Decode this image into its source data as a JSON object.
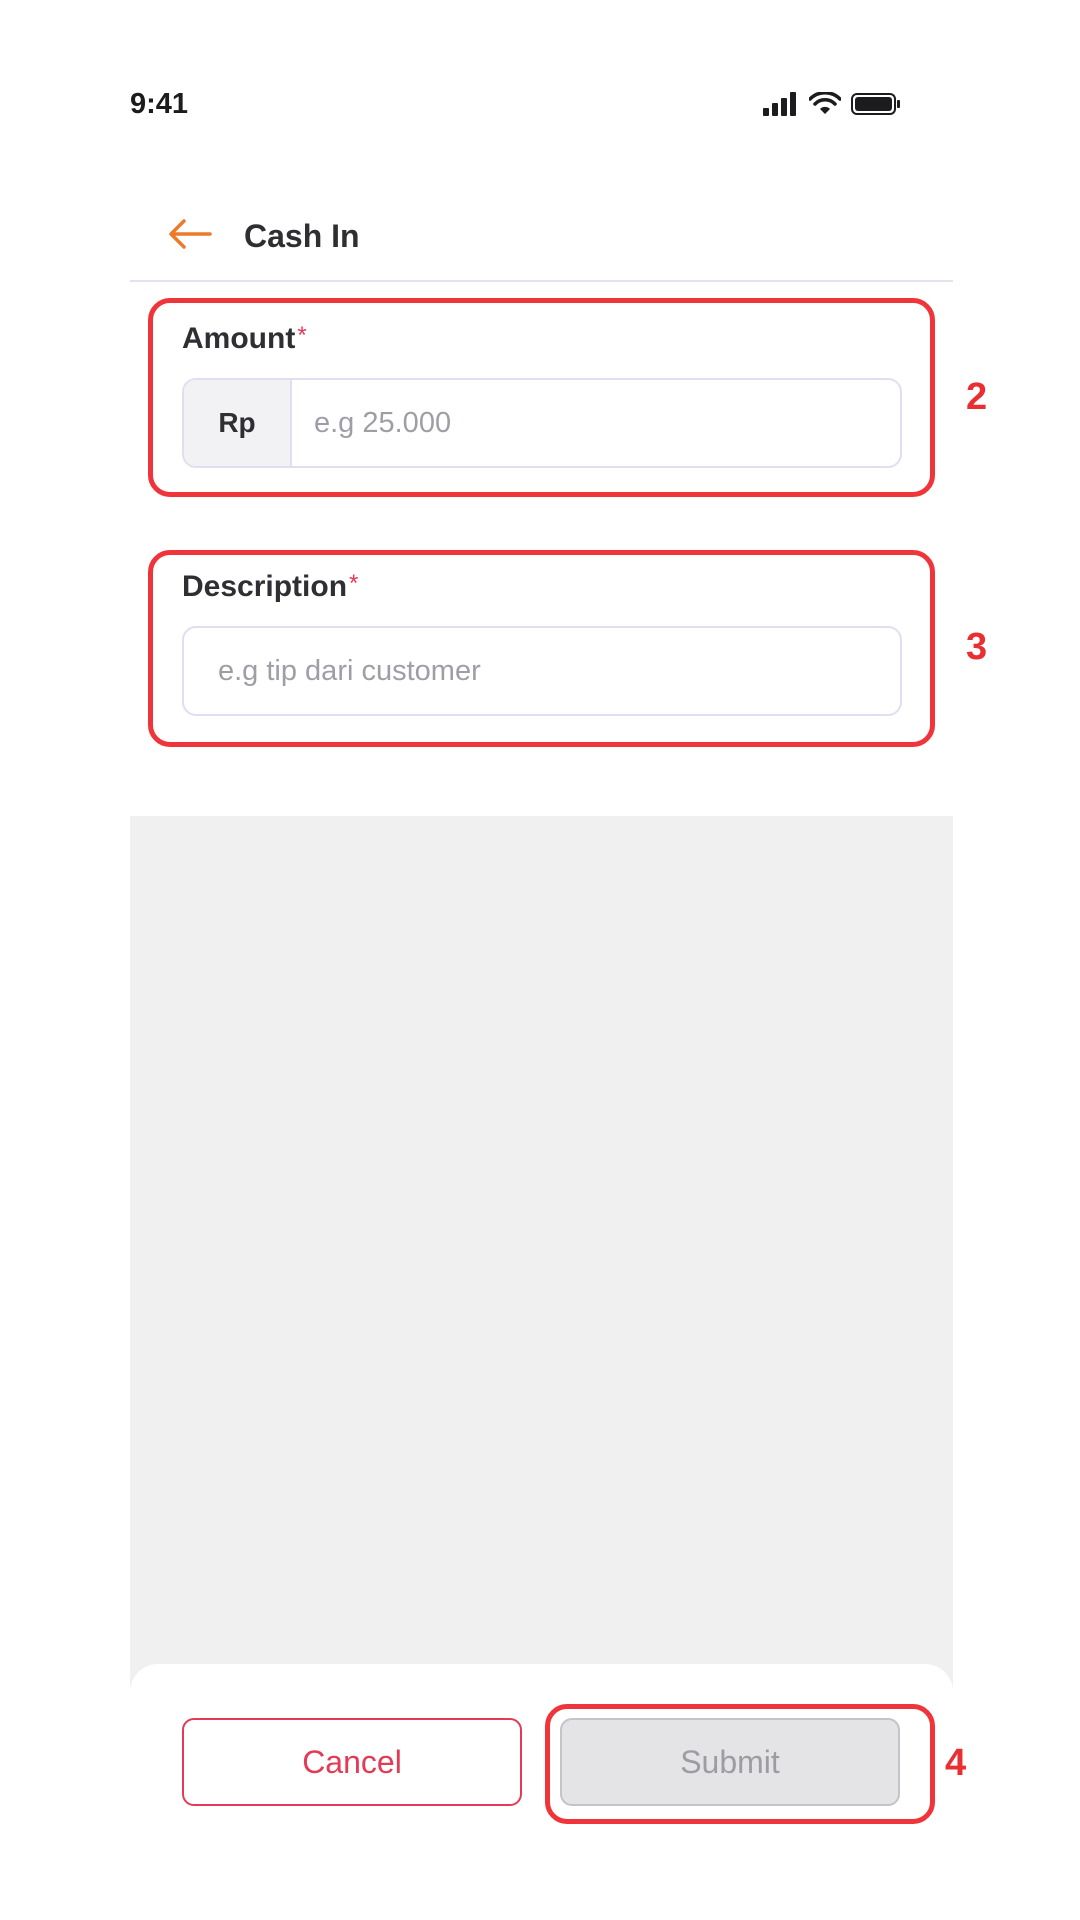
{
  "status_bar": {
    "time": "9:41",
    "signal_icon": "signal-bars-icon",
    "wifi_icon": "wifi-icon",
    "battery_icon": "battery-icon"
  },
  "header": {
    "back_icon": "arrow-left-icon",
    "title": "Cash In"
  },
  "form": {
    "amount": {
      "label": "Amount",
      "required_mark": "*",
      "prefix": "Rp",
      "placeholder": "e.g 25.000",
      "value": ""
    },
    "description": {
      "label": "Description",
      "required_mark": "*",
      "placeholder": "e.g tip dari customer",
      "value": ""
    }
  },
  "footer": {
    "cancel_label": "Cancel",
    "submit_label": "Submit"
  },
  "annotations": {
    "amount_marker": "2",
    "description_marker": "3",
    "submit_marker": "4"
  },
  "colors": {
    "accent_orange": "#ec7a2a",
    "danger_red": "#e53a55",
    "annotation_red": "#f0353a",
    "disabled_gray": "#e4e4e7"
  }
}
